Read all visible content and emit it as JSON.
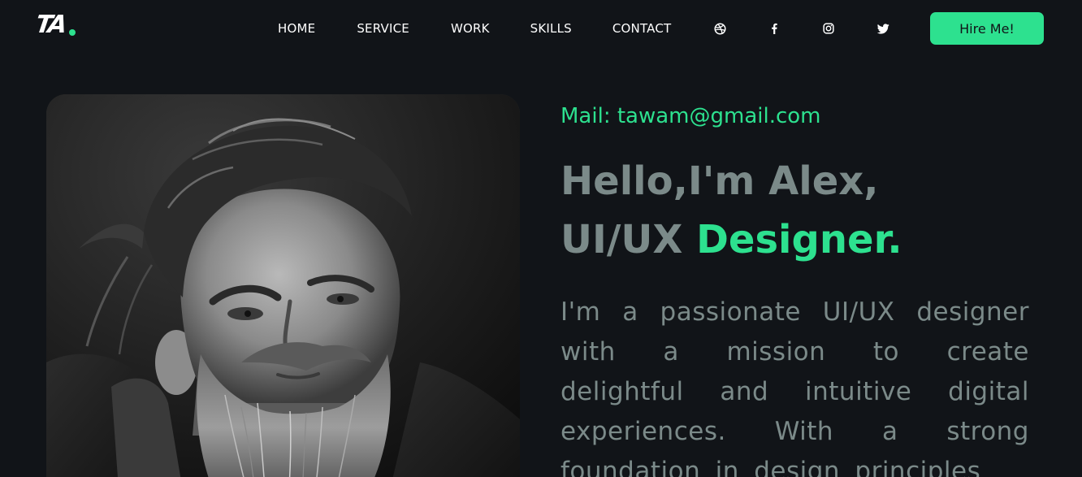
{
  "brand": {
    "logo_text": "TA",
    "accent_color": "#2de18f",
    "background_color": "#111418"
  },
  "nav": {
    "items": [
      {
        "label": "HOME"
      },
      {
        "label": "SERVICE"
      },
      {
        "label": "WORK"
      },
      {
        "label": "SKILLS"
      },
      {
        "label": "CONTACT"
      }
    ],
    "social": [
      {
        "icon": "dribbble-icon"
      },
      {
        "icon": "facebook-icon"
      },
      {
        "icon": "instagram-icon"
      },
      {
        "icon": "twitter-icon"
      }
    ],
    "cta_label": "Hire Me!"
  },
  "hero": {
    "mail": "Mail: tawam@gmail.com",
    "greeting": "Hello,I'm Alex,",
    "role_prefix": "UI/UX ",
    "role_accent": "Designer.",
    "intro": "I'm a passionate UI/UX designer with a mission to create delightful and intuitive digital experiences. With a strong foundation in design principles"
  }
}
